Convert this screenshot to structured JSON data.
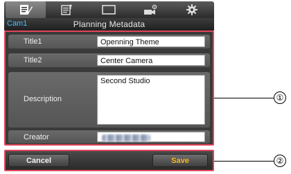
{
  "tabs": [
    {
      "icon": "metadata-list-icon",
      "active": true
    },
    {
      "icon": "metadata-edit-icon",
      "active": false
    },
    {
      "icon": "display-icon",
      "active": false
    },
    {
      "icon": "camera-settings-icon",
      "active": false
    },
    {
      "icon": "gear-icon",
      "active": false
    }
  ],
  "header": {
    "camera": "Cam1",
    "title": "Planning Metadata"
  },
  "fields": {
    "title1": {
      "label": "Title1",
      "value": "Openning Theme"
    },
    "title2": {
      "label": "Title2",
      "value": "Center Camera"
    },
    "description": {
      "label": "Description",
      "value": "Second Studio"
    },
    "creator": {
      "label": "Creator",
      "value": ""
    }
  },
  "buttons": {
    "cancel": "Cancel",
    "save": "Save"
  },
  "callouts": {
    "first": "①",
    "second": "②"
  },
  "colors": {
    "accent_cam": "#3ec6ff",
    "save_text": "#f5b52a",
    "highlight": "#e2455b"
  }
}
